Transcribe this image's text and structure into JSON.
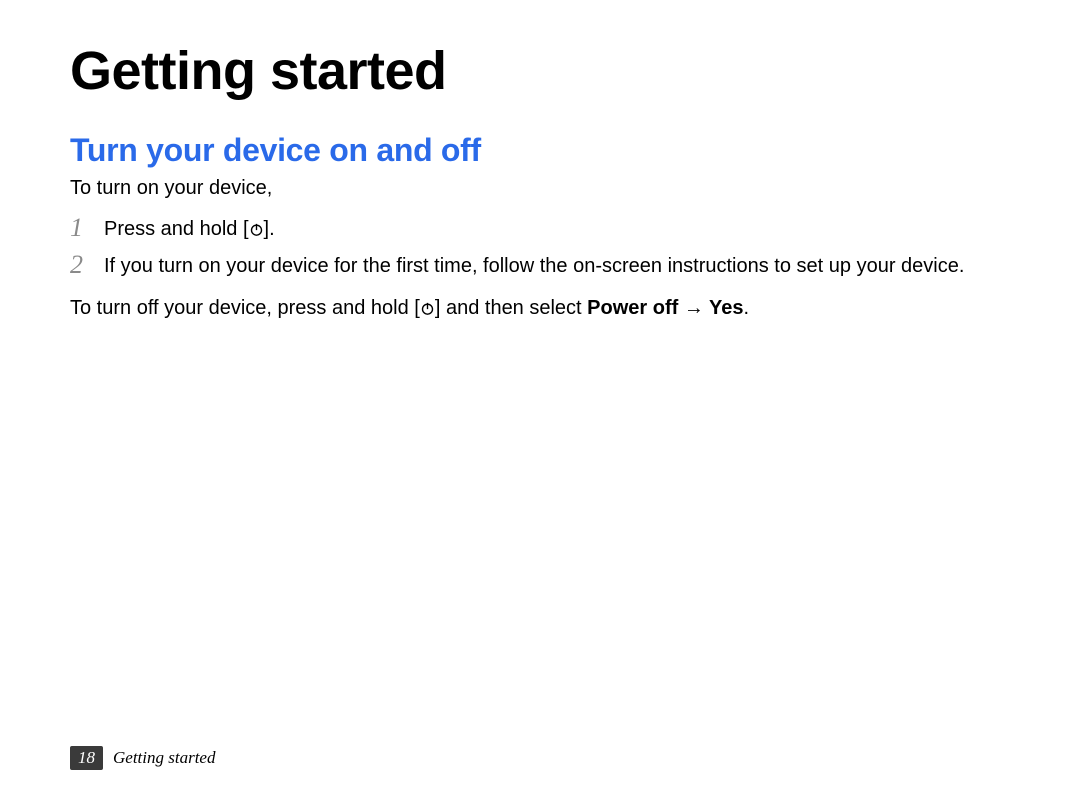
{
  "title": "Getting started",
  "section_heading": "Turn your device on and off",
  "intro": "To turn on your device,",
  "steps": [
    {
      "num": "1",
      "before": "Press and hold [",
      "after": "]."
    },
    {
      "num": "2",
      "text": "If you turn on your device for the first time, follow the on-screen instructions to set up your device."
    }
  ],
  "off_note": {
    "before": "To turn off your device, press and hold [",
    "mid": "] and then select ",
    "bold": "Power off → Yes",
    "after": "."
  },
  "footer": {
    "page_number": "18",
    "label": "Getting started"
  }
}
